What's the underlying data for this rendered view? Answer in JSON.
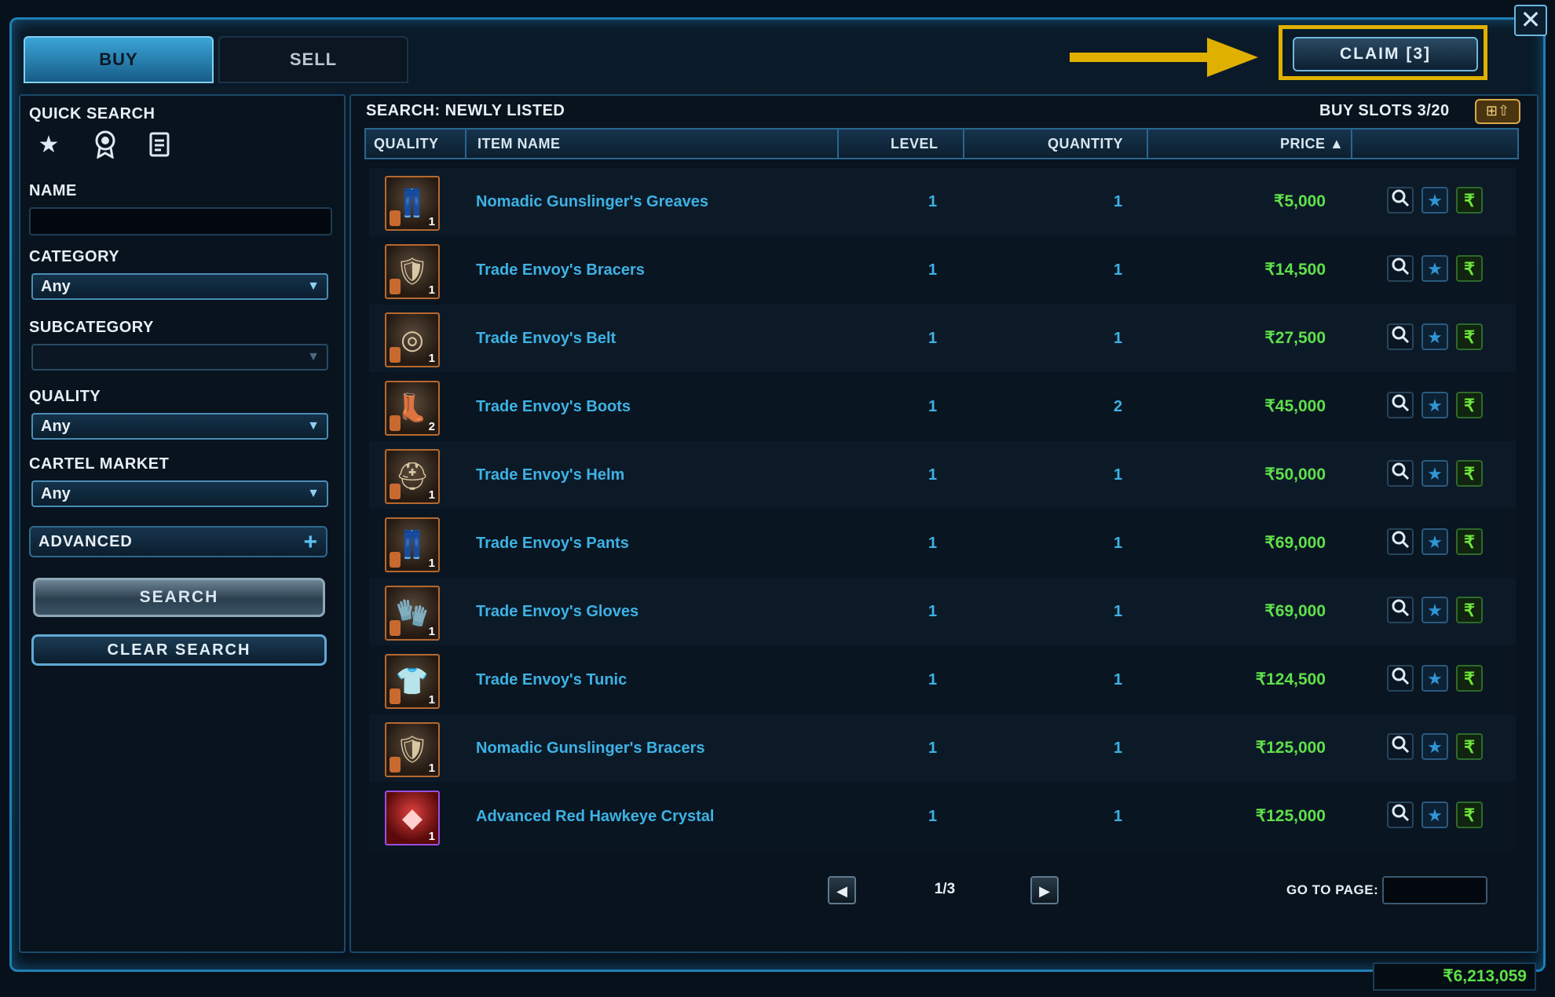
{
  "tabs": {
    "buy": "BUY",
    "sell": "SELL"
  },
  "claim_label": "CLAIM [3]",
  "left": {
    "quick_search_label": "QUICK SEARCH",
    "name_label": "NAME",
    "name_value": "",
    "category_label": "CATEGORY",
    "category_value": "Any",
    "subcategory_label": "SUBCATEGORY",
    "subcategory_value": "",
    "quality_label": "QUALITY",
    "quality_value": "Any",
    "cartel_label": "CARTEL MARKET",
    "cartel_value": "Any",
    "advanced_label": "ADVANCED",
    "search_label": "SEARCH",
    "clear_label": "CLEAR SEARCH"
  },
  "main": {
    "search_title": "SEARCH: NEWLY LISTED",
    "buy_slots": "BUY SLOTS 3/20",
    "columns": {
      "quality": "QUALITY",
      "item_name": "ITEM NAME",
      "level": "LEVEL",
      "quantity": "QUANTITY",
      "price": "PRICE ▲"
    },
    "rows": [
      {
        "name": "Nomadic Gunslinger's Greaves",
        "level": "1",
        "quantity": "1",
        "price": "₹5,000",
        "stack": "1",
        "quality_color": "#b7682e"
      },
      {
        "name": "Trade Envoy's Bracers",
        "level": "1",
        "quantity": "1",
        "price": "₹14,500",
        "stack": "1",
        "quality_color": "#b7682e"
      },
      {
        "name": "Trade Envoy's Belt",
        "level": "1",
        "quantity": "1",
        "price": "₹27,500",
        "stack": "1",
        "quality_color": "#b7682e"
      },
      {
        "name": "Trade Envoy's Boots",
        "level": "1",
        "quantity": "2",
        "price": "₹45,000",
        "stack": "2",
        "quality_color": "#b7682e"
      },
      {
        "name": "Trade Envoy's Helm",
        "level": "1",
        "quantity": "1",
        "price": "₹50,000",
        "stack": "1",
        "quality_color": "#b7682e"
      },
      {
        "name": "Trade Envoy's Pants",
        "level": "1",
        "quantity": "1",
        "price": "₹69,000",
        "stack": "1",
        "quality_color": "#b7682e"
      },
      {
        "name": "Trade Envoy's Gloves",
        "level": "1",
        "quantity": "1",
        "price": "₹69,000",
        "stack": "1",
        "quality_color": "#b7682e"
      },
      {
        "name": "Trade Envoy's Tunic",
        "level": "1",
        "quantity": "1",
        "price": "₹124,500",
        "stack": "1",
        "quality_color": "#b7682e"
      },
      {
        "name": "Nomadic Gunslinger's Bracers",
        "level": "1",
        "quantity": "1",
        "price": "₹125,000",
        "stack": "1",
        "quality_color": "#b7682e"
      },
      {
        "name": "Advanced Red Hawkeye Crystal",
        "level": "1",
        "quantity": "1",
        "price": "₹125,000",
        "stack": "1",
        "quality_color": "#9a4ee0"
      }
    ],
    "page": "1/3",
    "goto_label": "GO TO PAGE:",
    "goto_value": ""
  },
  "credits": "₹6,213,059",
  "icons": {
    "quick_search": [
      "star-icon",
      "award-icon",
      "document-icon"
    ],
    "row_actions": [
      "magnifier-icon",
      "star-icon",
      "credits-icon"
    ]
  },
  "colors": {
    "accent": "#1f7fb4",
    "item_link": "#3eb2e4",
    "price": "#5fe04a",
    "highlight": "#e0b000"
  }
}
